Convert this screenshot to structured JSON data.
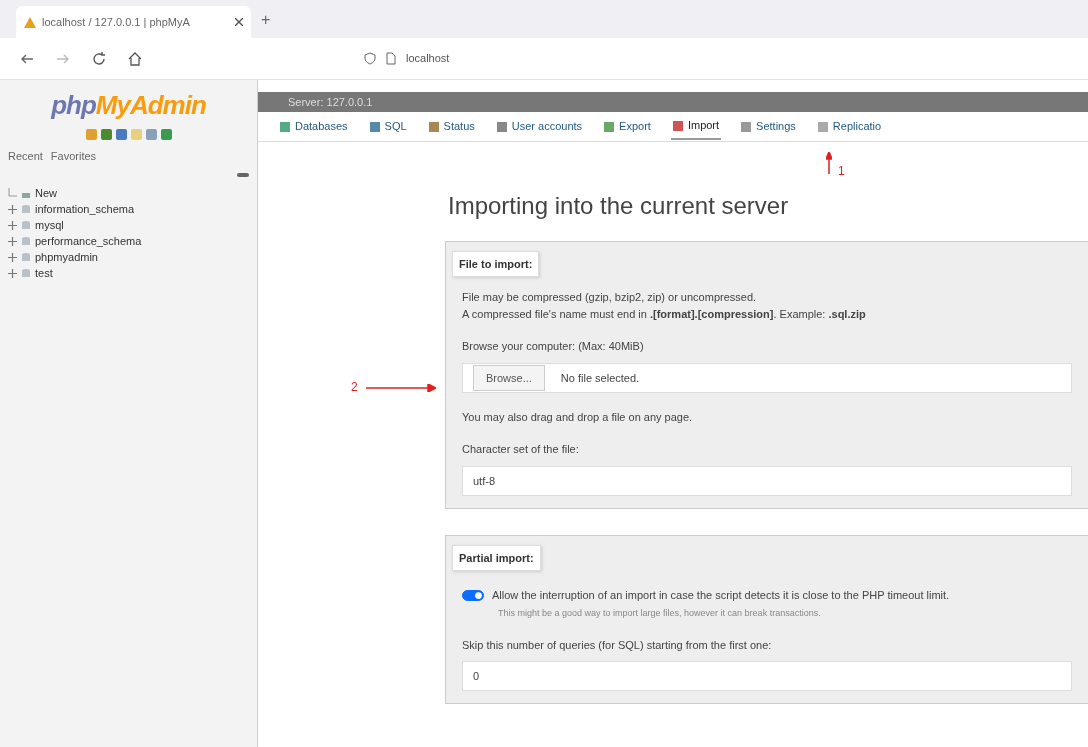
{
  "browser": {
    "tab_title": "localhost / 127.0.0.1 | phpMyA",
    "new_tab": "+",
    "url": "localhost"
  },
  "sidebar": {
    "logo_php": "php",
    "logo_my": "MyAdmin",
    "links": [
      "Recent",
      "Favorites"
    ],
    "tree": [
      {
        "label": "New",
        "kind": "new"
      },
      {
        "label": "information_schema",
        "kind": "db"
      },
      {
        "label": "mysql",
        "kind": "db"
      },
      {
        "label": "performance_schema",
        "kind": "db"
      },
      {
        "label": "phpmyadmin",
        "kind": "db"
      },
      {
        "label": "test",
        "kind": "db"
      }
    ]
  },
  "breadcrumb": "Server: 127.0.0.1",
  "tabs": [
    {
      "label": "Databases",
      "selected": false
    },
    {
      "label": "SQL",
      "selected": false
    },
    {
      "label": "Status",
      "selected": false
    },
    {
      "label": "User accounts",
      "selected": false
    },
    {
      "label": "Export",
      "selected": false
    },
    {
      "label": "Import",
      "selected": true
    },
    {
      "label": "Settings",
      "selected": false
    },
    {
      "label": "Replicatio",
      "selected": false
    }
  ],
  "annotations": [
    "1",
    "2"
  ],
  "heading": "Importing into the current server",
  "file_to_import": {
    "legend": "File to import:",
    "notes": [
      "File may be compressed (gzip, bzip2, zip) or uncompressed.",
      "A compressed file's name must end in **.[format].[compression]**. Example: **.sql.zip**"
    ],
    "browse_label": "Browse your computer: (Max: 40MiB)",
    "browse_button": "Browse...",
    "file_status": "No file selected.",
    "drag_note": "You may also drag and drop a file on any page.",
    "charset_label": "Character set of the file:",
    "charset": "utf-8"
  },
  "partial_import": {
    "legend": "Partial import:",
    "allow_interrupt": {
      "label": "Allow the interruption of an import in case the script detects it is close to the PHP timeout limit.",
      "on": true
    },
    "hint": "This might be a good way to import large files, however it can break transactions.",
    "skip_label": "Skip this number of queries (for SQL) starting from the first one:",
    "skip_value": "0"
  }
}
